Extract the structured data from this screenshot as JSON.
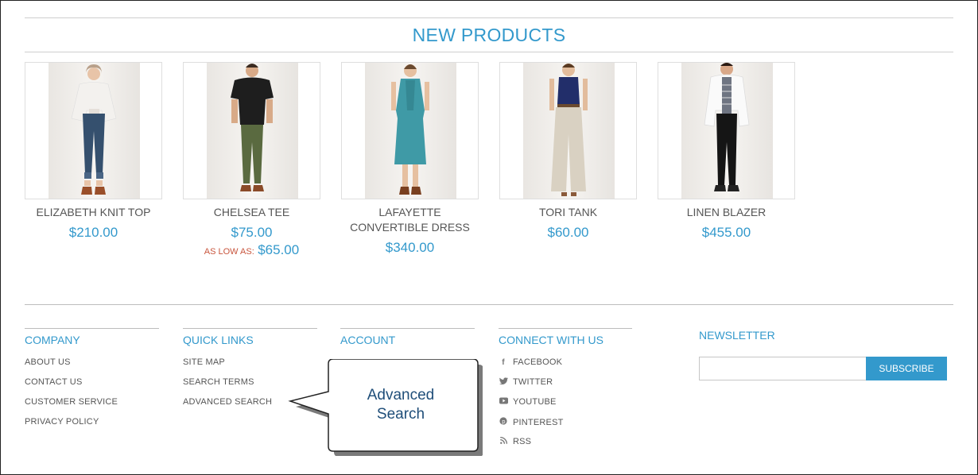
{
  "section_title": "NEW PRODUCTS",
  "products": [
    {
      "name_lines": [
        "ELIZABETH KNIT TOP"
      ],
      "price": "$210.00"
    },
    {
      "name_lines": [
        "CHELSEA TEE"
      ],
      "price": "$75.00",
      "as_low_as_label": "AS LOW AS:",
      "as_low_as_price": "$65.00"
    },
    {
      "name_lines": [
        "LAFAYETTE",
        "CONVERTIBLE DRESS"
      ],
      "price": "$340.00"
    },
    {
      "name_lines": [
        "TORI TANK"
      ],
      "price": "$60.00"
    },
    {
      "name_lines": [
        "LINEN BLAZER"
      ],
      "price": "$455.00"
    }
  ],
  "footer": {
    "company": {
      "title": "COMPANY",
      "links": [
        "ABOUT US",
        "CONTACT US",
        "CUSTOMER SERVICE",
        "PRIVACY POLICY"
      ]
    },
    "quick_links": {
      "title": "QUICK LINKS",
      "links": [
        "SITE MAP",
        "SEARCH TERMS",
        "ADVANCED SEARCH"
      ]
    },
    "account": {
      "title": "ACCOUNT"
    },
    "connect": {
      "title": "CONNECT WITH US",
      "links": [
        {
          "label": "FACEBOOK",
          "icon": "facebook-icon"
        },
        {
          "label": "TWITTER",
          "icon": "twitter-icon"
        },
        {
          "label": "YOUTUBE",
          "icon": "youtube-icon"
        },
        {
          "label": "PINTEREST",
          "icon": "pinterest-icon"
        },
        {
          "label": "RSS",
          "icon": "rss-icon"
        }
      ]
    },
    "newsletter": {
      "title": "NEWSLETTER",
      "subscribe_label": "SUBSCRIBE"
    }
  },
  "callout": {
    "line1": "Advanced",
    "line2": "Search"
  },
  "colors": {
    "accent": "#3399cc",
    "sale": "#c8553d",
    "callout_text": "#1f4e79"
  }
}
